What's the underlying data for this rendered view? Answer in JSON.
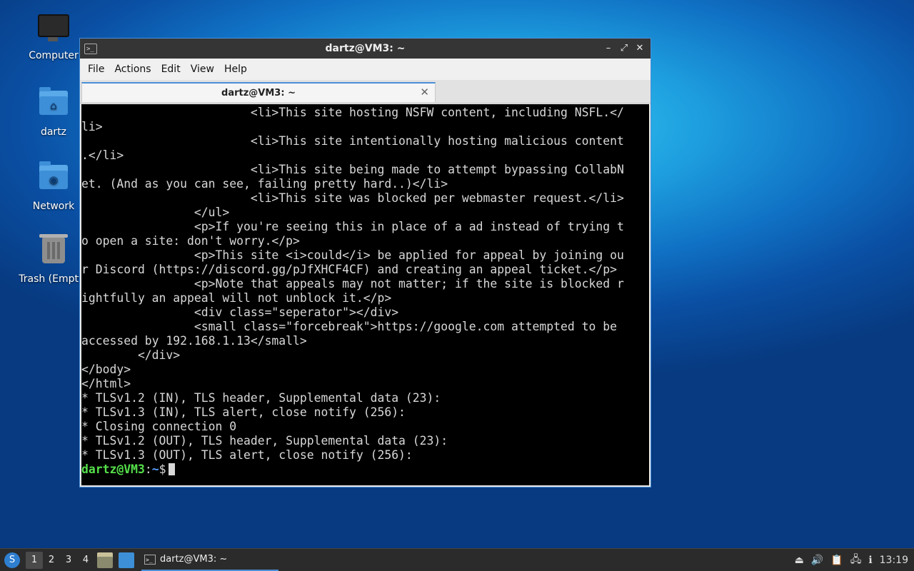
{
  "desktop": {
    "icons": [
      {
        "label": "Computer"
      },
      {
        "label": "dartz"
      },
      {
        "label": "Network"
      },
      {
        "label": "Trash (Empty)"
      }
    ]
  },
  "window": {
    "title": "dartz@VM3: ~",
    "menu": [
      "File",
      "Actions",
      "Edit",
      "View",
      "Help"
    ],
    "tab_label": "dartz@VM3: ~"
  },
  "terminal": {
    "lines": [
      "                        <li>This site hosting NSFW content, including NSFL.</",
      "li>",
      "                        <li>This site intentionally hosting malicious content",
      ".</li>",
      "                        <li>This site being made to attempt bypassing CollabN",
      "et. (And as you can see, failing pretty hard..)</li>",
      "                        <li>This site was blocked per webmaster request.</li>",
      "                </ul>",
      "                <p>If you're seeing this in place of a ad instead of trying t",
      "o open a site: don't worry.</p>",
      "                <p>This site <i>could</i> be applied for appeal by joining ou",
      "r Discord (https://discord.gg/pJfXHCF4CF) and creating an appeal ticket.</p>",
      "                <p>Note that appeals may not matter; if the site is blocked r",
      "ightfully an appeal will not unblock it.</p>",
      "                <div class=\"seperator\"></div>",
      "                <small class=\"forcebreak\">https://google.com attempted to be",
      "accessed by 192.168.1.13</small>",
      "        </div>",
      "</body>",
      "</html>",
      "* TLSv1.2 (IN), TLS header, Supplemental data (23):",
      "* TLSv1.3 (IN), TLS alert, close notify (256):",
      "* Closing connection 0",
      "* TLSv1.2 (OUT), TLS header, Supplemental data (23):",
      "* TLSv1.3 (OUT), TLS alert, close notify (256):"
    ],
    "prompt_user": "dartz@VM3",
    "prompt_sep": ":",
    "prompt_path": "~",
    "prompt_symbol": "$"
  },
  "taskbar": {
    "workspaces": [
      "1",
      "2",
      "3",
      "4"
    ],
    "active_workspace": "1",
    "task_label": "dartz@VM3: ~",
    "clock": "13:19",
    "icons": [
      "start-menu-icon",
      "file-manager-icon",
      "desktop-icon",
      "terminal-icon",
      "eject-icon",
      "volume-icon",
      "clipboard-icon",
      "network-icon",
      "update-icon"
    ]
  }
}
